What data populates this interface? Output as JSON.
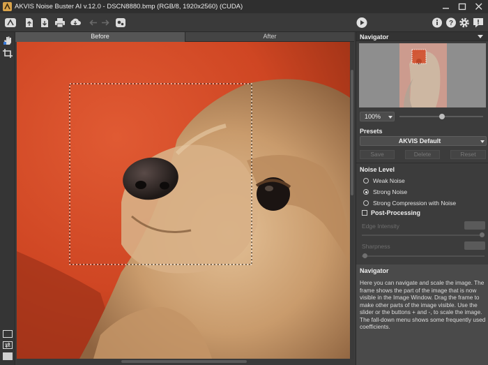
{
  "window": {
    "title": "AKVIS Noise Buster AI v.12.0 - DSCN8880.bmp (RGB/8, 1920x2560) (CUDA)",
    "controls": [
      "minimize-icon",
      "maximize-icon",
      "close-icon"
    ]
  },
  "toolbar": {
    "left_icons": [
      "akvis-logo-icon",
      "open-icon",
      "save-icon",
      "print-icon",
      "download-icon",
      "undo-icon",
      "redo-icon",
      "settings-plugins-icon"
    ],
    "right_icons": [
      "run-icon",
      "info-icon",
      "help-icon",
      "gear-icon",
      "alert-icon"
    ]
  },
  "left_tools": [
    "hand-icon",
    "crop-icon"
  ],
  "view_tabs": {
    "before": "Before",
    "after": "After",
    "active": "Before"
  },
  "navigator": {
    "title": "Navigator",
    "zoom": "100%"
  },
  "presets": {
    "title": "Presets",
    "selected": "AKVIS Default",
    "save": "Save",
    "delete": "Delete",
    "reset": "Reset"
  },
  "noise_level": {
    "title": "Noise Level",
    "options": [
      "Weak Noise",
      "Strong Noise",
      "Strong Compression with Noise"
    ],
    "selected": "Strong Noise"
  },
  "post_processing": {
    "label": "Post-Processing",
    "checked": false,
    "edge_intensity_label": "Edge Intensity",
    "sharpness_label": "Sharpness"
  },
  "help": {
    "title": "Navigator",
    "text": "Here you can navigate and scale the image. The frame shows the part of the image that is now visible in the Image Window. Drag the frame to make other parts of the image visible. Use the slider or the buttons + and -, to scale the image. The fall-down menu shows some frequently used coefficients."
  },
  "colors": {
    "background": "#3c3c3c",
    "photo_red": "#d24a26"
  }
}
